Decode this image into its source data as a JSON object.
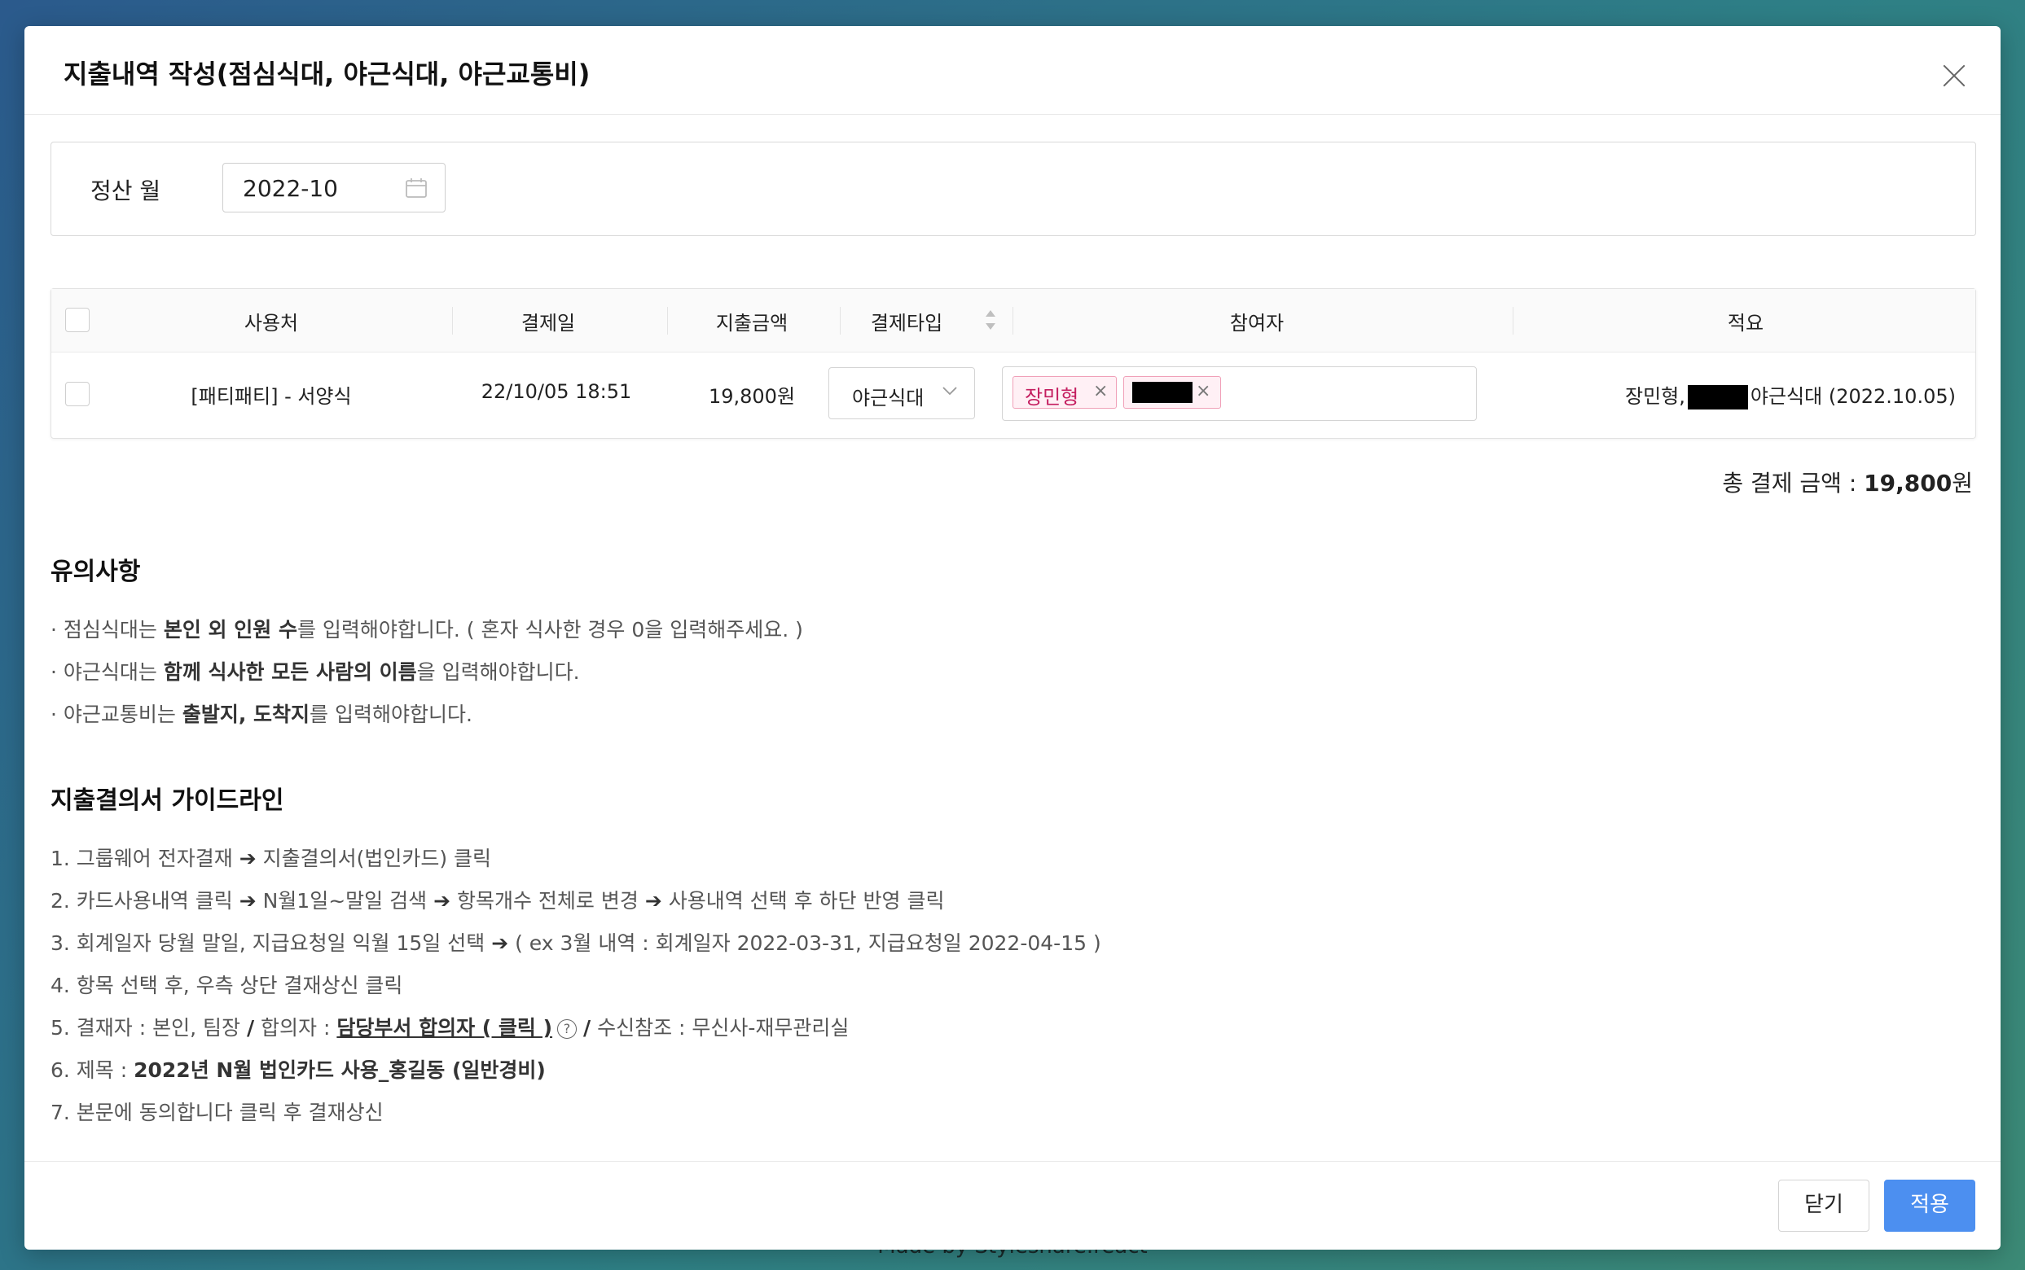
{
  "footer_credit": "Made by Styleshare.react",
  "modal": {
    "title": "지출내역 작성(점심식대, 야근식대, 야근교통비)"
  },
  "filter": {
    "label": "정산 월",
    "month_value": "2022-10"
  },
  "table": {
    "headers": [
      "사용처",
      "결제일",
      "지출금액",
      "결제타입",
      "참여자",
      "적요"
    ],
    "rows": [
      {
        "place": "[패티패티] - 서양식",
        "date": "22/10/05 18:51",
        "amount": "19,800원",
        "type": "야근식대",
        "participants": [
          "장민형"
        ],
        "memo_prefix": "장민형,",
        "memo_suffix": "야근식대 (2022.10.05)"
      }
    ]
  },
  "total": {
    "label": "총 결제 금액 : ",
    "value": "19,800",
    "unit": "원"
  },
  "notice": {
    "title": "유의사항",
    "items": [
      {
        "pre": "· 점심식대는 ",
        "bold": "본인 외 인원 수",
        "post": "를 입력해야합니다. ( 혼자 식사한 경우 0을 입력해주세요. )"
      },
      {
        "pre": "· 야근식대는 ",
        "bold": "함께 식사한 모든 사람의 이름",
        "post": "을 입력해야합니다."
      },
      {
        "pre": "· 야근교통비는 ",
        "bold": "출발지, 도착지",
        "post": "를 입력해야합니다."
      }
    ]
  },
  "guide": {
    "title": "지출결의서 가이드라인",
    "line1": {
      "a": "1. 그룹웨어 전자결재 ",
      "b": " 지출결의서(법인카드) 클릭"
    },
    "line2": {
      "a": "2. 카드사용내역 클릭 ",
      "b": " N월1일~말일 검색 ",
      "c": " 항목개수 전체로 변경 ",
      "d": " 사용내역 선택 후 하단 반영 클릭"
    },
    "line3": {
      "a": "3. 회계일자 당월 말일, 지급요청일 익월 15일 선택 ",
      "b": " ( ex 3월 내역 : 회계일자 2022-03-31, 지급요청일 2022-04-15 )"
    },
    "line4": "4. 항목 선택 후, 우측 상단 결재상신 클릭",
    "line5": {
      "a": "5. 결재자 : 본인, 팀장 ",
      "sep": "/",
      "b": " 합의자 : ",
      "link": "담당부서 합의자 ( 클릭 )",
      "help": "?",
      "c": " 수신참조 : 무신사-재무관리실"
    },
    "line6": {
      "a": "6. 제목 : ",
      "bold": "2022년 N월 법인카드 사용_홍길동 (일반경비)"
    },
    "line7": "7. 본문에 동의합니다 클릭 후 결재상신",
    "arrow": "➔"
  },
  "footer": {
    "close_label": "닫기",
    "apply_label": "적용"
  },
  "colors": {
    "primary": "#4c8ff0",
    "tag_border": "#f0a0b8",
    "tag_text": "#c41d5f"
  }
}
